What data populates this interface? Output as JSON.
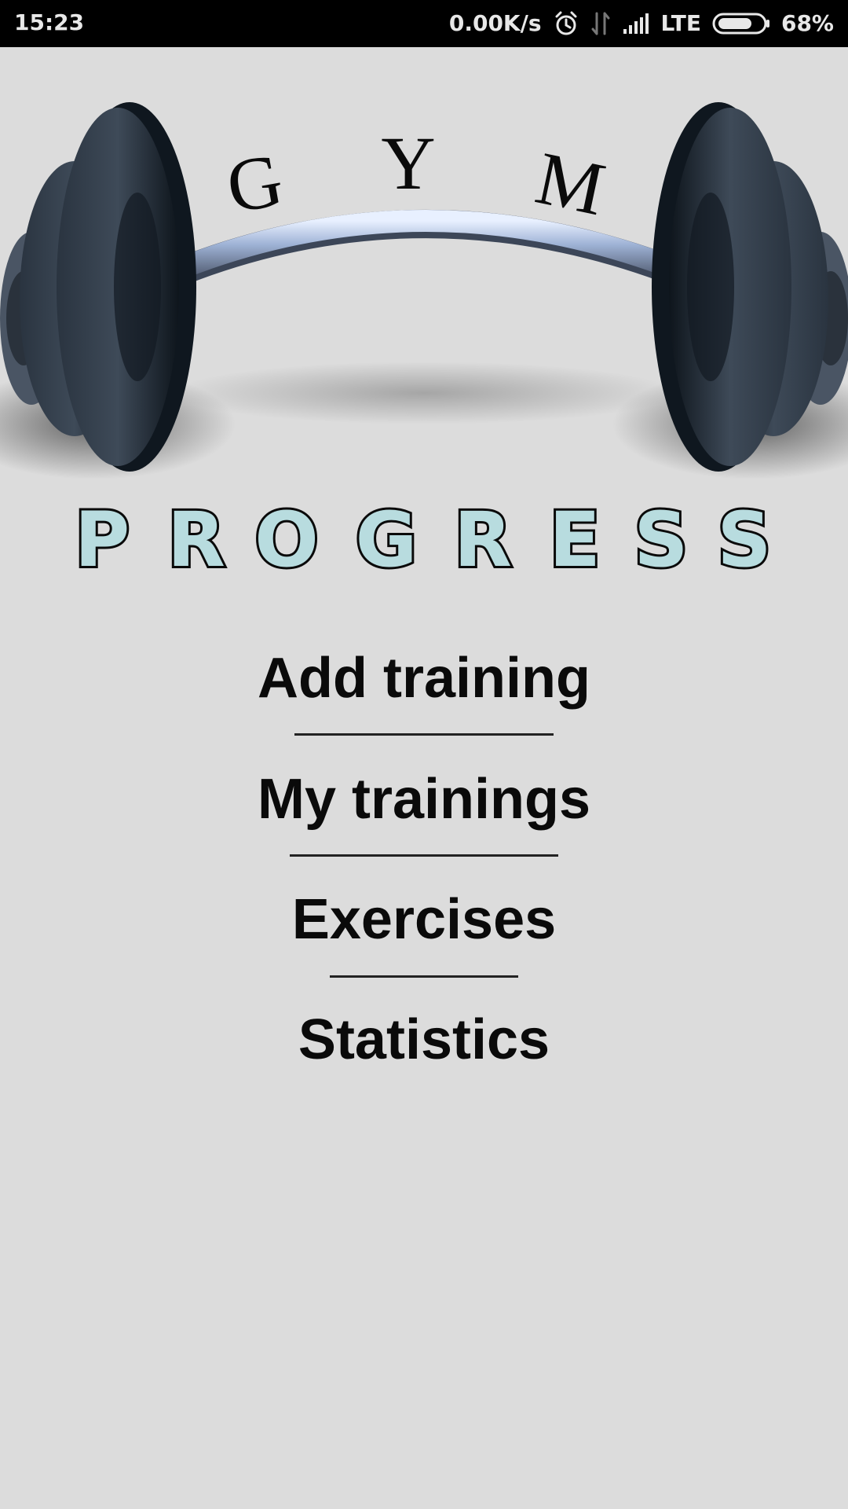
{
  "status_bar": {
    "time": "15:23",
    "net_speed": "0.00K/s",
    "network_type": "LTE",
    "battery": "68%",
    "icons": [
      "alarm-icon",
      "data-arrows-icon",
      "signal-icon",
      "battery-icon"
    ]
  },
  "logo": {
    "top_word": "GYM",
    "bottom_word": "PROGRESS",
    "letter_fill": "#b8dcdf",
    "plate_color": "#1c2630",
    "bar_color": "#9fb3d6"
  },
  "menu": {
    "items": [
      {
        "label": "Add training"
      },
      {
        "label": "My trainings"
      },
      {
        "label": "Exercises"
      },
      {
        "label": "Statistics"
      }
    ]
  },
  "colors": {
    "background": "#dcdcdc",
    "text": "#0a0a0a",
    "status_bar": "#000000"
  }
}
